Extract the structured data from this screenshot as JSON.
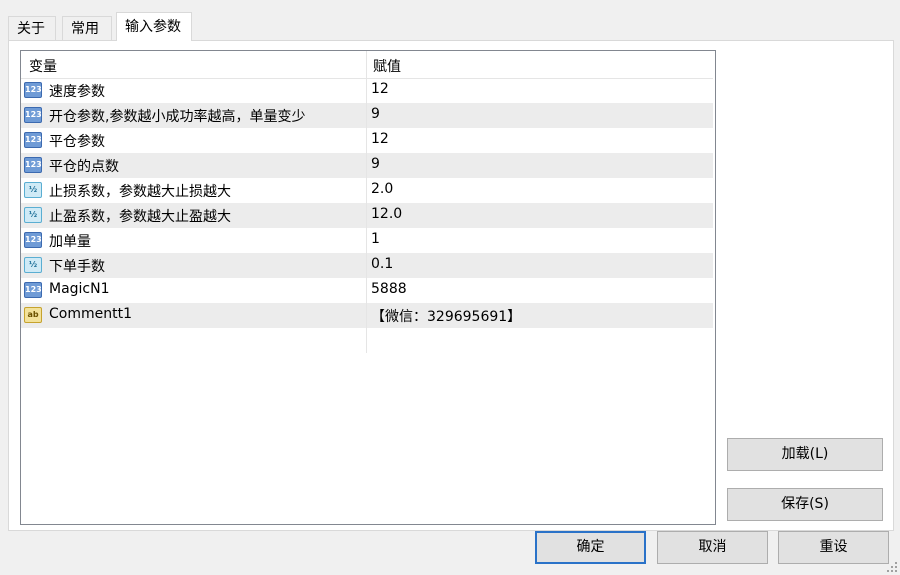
{
  "tabs": [
    {
      "label": "关于"
    },
    {
      "label": "常用"
    },
    {
      "label": "输入参数",
      "active": true
    }
  ],
  "grid": {
    "headers": {
      "name": "变量",
      "value": "赋值"
    },
    "rows": [
      {
        "type": "int",
        "icon_text": "123",
        "name": "速度参数",
        "value": "12"
      },
      {
        "type": "int",
        "icon_text": "123",
        "name": "开仓参数,参数越小成功率越高，单量变少",
        "value": "9"
      },
      {
        "type": "int",
        "icon_text": "123",
        "name": "平仓参数",
        "value": "12"
      },
      {
        "type": "int",
        "icon_text": "123",
        "name": "平仓的点数",
        "value": "9"
      },
      {
        "type": "double",
        "icon_text": "½",
        "name": "止损系数，参数越大止损越大",
        "value": "2.0"
      },
      {
        "type": "double",
        "icon_text": "½",
        "name": "止盈系数，参数越大止盈越大",
        "value": "12.0"
      },
      {
        "type": "int",
        "icon_text": "123",
        "name": "加单量",
        "value": "1"
      },
      {
        "type": "double",
        "icon_text": "½",
        "name": "下单手数",
        "value": "0.1"
      },
      {
        "type": "int",
        "icon_text": "123",
        "name": "MagicN1",
        "value": "5888"
      },
      {
        "type": "string",
        "icon_text": "ab",
        "name": "Commentt1",
        "value": "【微信：329695691】"
      }
    ]
  },
  "side_buttons": {
    "load": "加载(L)",
    "save": "保存(S)"
  },
  "footer_buttons": {
    "ok": "确定",
    "cancel": "取消",
    "reset": "重设"
  }
}
